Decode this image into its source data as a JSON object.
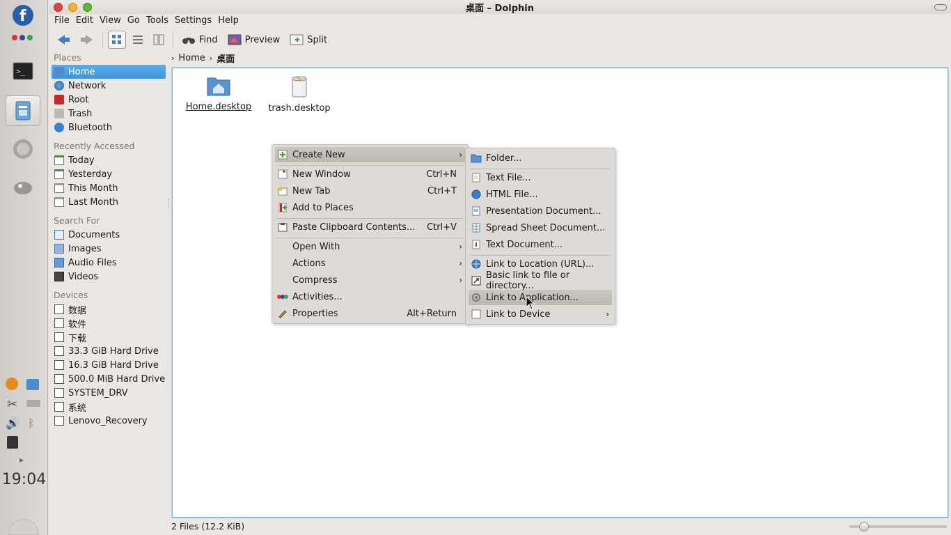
{
  "dock": {
    "clock": "19:04",
    "items": [
      "fedora-icon",
      "dots-icon",
      "terminal-icon",
      "dolphin-icon",
      "firefox-icon",
      "gimp-icon"
    ]
  },
  "window": {
    "title": "桌面 – Dolphin"
  },
  "menubar": [
    "File",
    "Edit",
    "View",
    "Go",
    "Tools",
    "Settings",
    "Help"
  ],
  "toolbar": {
    "find": "Find",
    "preview": "Preview",
    "split": "Split"
  },
  "places": {
    "title": "Places",
    "items": [
      "Home",
      "Network",
      "Root",
      "Trash",
      "Bluetooth"
    ],
    "recent_title": "Recently Accessed",
    "recent": [
      "Today",
      "Yesterday",
      "This Month",
      "Last Month"
    ],
    "search_title": "Search For",
    "search": [
      "Documents",
      "Images",
      "Audio Files",
      "Videos"
    ],
    "devices_title": "Devices",
    "devices": [
      "数据",
      "软件",
      "下载",
      "33.3 GiB Hard Drive",
      "16.3 GiB Hard Drive",
      "500.0 MiB Hard Drive",
      "SYSTEM_DRV",
      "系统",
      "Lenovo_Recovery"
    ]
  },
  "breadcrumb": [
    "Home",
    "桌面"
  ],
  "files": [
    "Home.desktop",
    "trash.desktop"
  ],
  "status": "2 Files (12.2 KiB)",
  "context_menu": {
    "items": [
      {
        "label": "Create New",
        "shortcut": "",
        "submenu": true
      },
      {
        "label": "New Window",
        "shortcut": "Ctrl+N",
        "submenu": false
      },
      {
        "label": "New Tab",
        "shortcut": "Ctrl+T",
        "submenu": false
      },
      {
        "label": "Add to Places",
        "shortcut": "",
        "submenu": false
      },
      {
        "label": "Paste Clipboard Contents...",
        "shortcut": "Ctrl+V",
        "submenu": false
      },
      {
        "label": "Open With",
        "shortcut": "",
        "submenu": true
      },
      {
        "label": "Actions",
        "shortcut": "",
        "submenu": true
      },
      {
        "label": "Compress",
        "shortcut": "",
        "submenu": true
      },
      {
        "label": "Activities...",
        "shortcut": "",
        "submenu": false
      },
      {
        "label": "Properties",
        "shortcut": "Alt+Return",
        "submenu": false
      }
    ]
  },
  "create_new_menu": {
    "items": [
      {
        "label": "Folder...",
        "submenu": false
      },
      {
        "label": "Text File...",
        "submenu": false
      },
      {
        "label": "HTML File...",
        "submenu": false
      },
      {
        "label": "Presentation Document...",
        "submenu": false
      },
      {
        "label": "Spread Sheet Document...",
        "submenu": false
      },
      {
        "label": "Text Document...",
        "submenu": false
      },
      {
        "label": "Link to Location (URL)...",
        "submenu": false
      },
      {
        "label": "Basic link to file or directory...",
        "submenu": false
      },
      {
        "label": "Link to Application...",
        "submenu": false
      },
      {
        "label": "Link to Device",
        "submenu": true
      }
    ]
  },
  "colors": {
    "selection": "#3f93d9",
    "view_border": "#6fb6e8",
    "close": "#e0443a",
    "minimize": "#f0b52c",
    "maximize": "#5fb537"
  }
}
